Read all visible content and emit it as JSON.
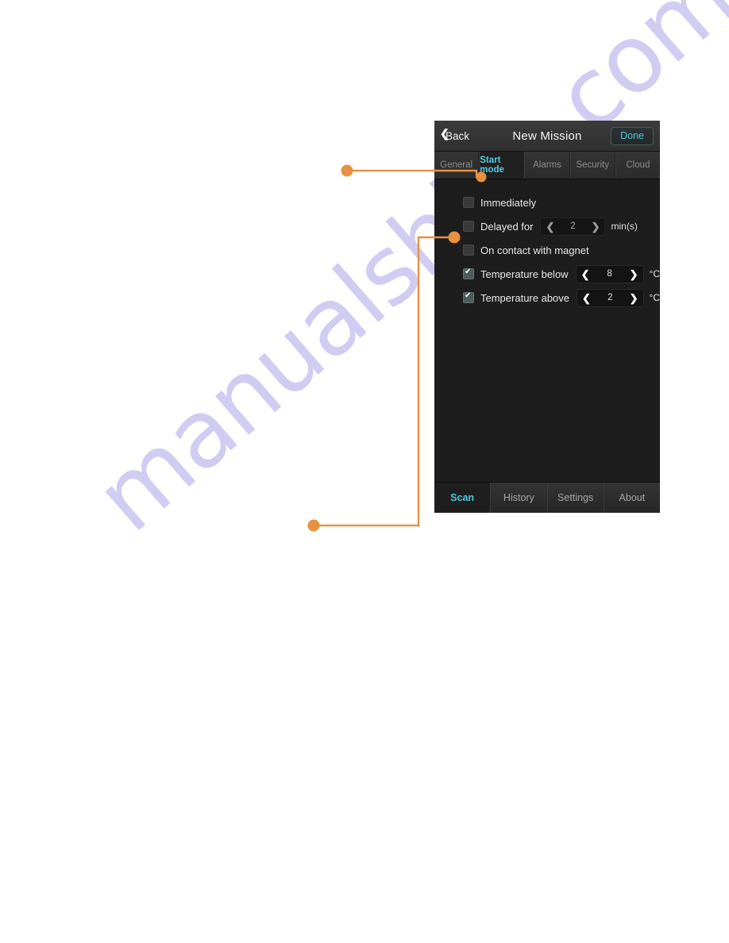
{
  "watermark": {
    "text": "manualshive.com",
    "color": "#c9c4ef"
  },
  "annotation": {
    "color": "#e8913f"
  },
  "phone": {
    "nav": {
      "back_label": "Back",
      "back_icon": "chevron-left-icon",
      "title": "New Mission",
      "done_label": "Done",
      "done_color": "#4cc6dd"
    },
    "tabs": [
      {
        "label": "General",
        "active": false
      },
      {
        "label": "Start mode",
        "active": true
      },
      {
        "label": "Alarms",
        "active": false
      },
      {
        "label": "Security",
        "active": false
      },
      {
        "label": "Cloud",
        "active": false
      }
    ],
    "options": [
      {
        "label": "Immediately",
        "checked": false,
        "stepper": null
      },
      {
        "label": "Delayed for",
        "checked": false,
        "stepper": {
          "value": "2",
          "unit": "min(s)",
          "enabled": false
        }
      },
      {
        "label": "On contact with magnet",
        "checked": false,
        "stepper": null
      },
      {
        "label": "Temperature below",
        "checked": true,
        "stepper": {
          "value": "8",
          "unit": "°C",
          "enabled": true
        }
      },
      {
        "label": "Temperature above",
        "checked": true,
        "stepper": {
          "value": "2",
          "unit": "°C",
          "enabled": true
        }
      }
    ],
    "stepper_icons": {
      "decrement": "chevron-left-icon",
      "increment": "chevron-right-icon"
    },
    "stepper_glyphs": {
      "decrement": "❮",
      "increment": "❯"
    },
    "bottom_tabs": [
      {
        "label": "Scan",
        "active": true
      },
      {
        "label": "History",
        "active": false
      },
      {
        "label": "Settings",
        "active": false
      },
      {
        "label": "About",
        "active": false
      }
    ]
  }
}
